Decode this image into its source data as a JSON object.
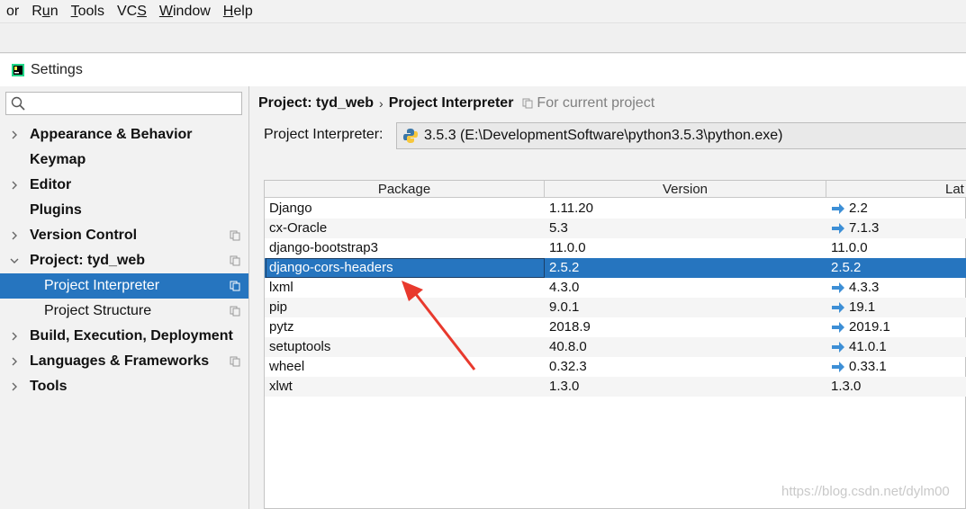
{
  "menubar": {
    "items": [
      {
        "label": "or",
        "underline": ""
      },
      {
        "label_pre": "R",
        "label_u": "u",
        "label_post": "n"
      },
      {
        "label_pre": "",
        "label_u": "T",
        "label_post": "ools"
      },
      {
        "label_pre": "VC",
        "label_u": "S",
        "label_post": ""
      },
      {
        "label_pre": "",
        "label_u": "W",
        "label_post": "indow"
      },
      {
        "label_pre": "",
        "label_u": "H",
        "label_post": "elp"
      }
    ]
  },
  "window": {
    "title": "Settings"
  },
  "sidebar": {
    "search_placeholder": "",
    "items": [
      {
        "label": "Appearance & Behavior",
        "bold": true,
        "arrow": "right"
      },
      {
        "label": "Keymap",
        "bold": true,
        "arrow": ""
      },
      {
        "label": "Editor",
        "bold": true,
        "arrow": "right"
      },
      {
        "label": "Plugins",
        "bold": true,
        "arrow": ""
      },
      {
        "label": "Version Control",
        "bold": true,
        "arrow": "right",
        "copy": true
      },
      {
        "label": "Project: tyd_web",
        "bold": true,
        "arrow": "down",
        "copy": true
      },
      {
        "label": "Project Interpreter",
        "bold": false,
        "child": true,
        "selected": true,
        "copy": true
      },
      {
        "label": "Project Structure",
        "bold": false,
        "child": true,
        "copy": true
      },
      {
        "label": "Build, Execution, Deployment",
        "bold": true,
        "arrow": "right"
      },
      {
        "label": "Languages & Frameworks",
        "bold": true,
        "arrow": "right",
        "copy": true
      },
      {
        "label": "Tools",
        "bold": true,
        "arrow": "right"
      }
    ]
  },
  "main": {
    "breadcrumb": {
      "project": "Project: tyd_web",
      "separator": "›",
      "page": "Project Interpreter",
      "scope": "For current project"
    },
    "interpreter": {
      "label": "Project Interpreter:",
      "value": "3.5.3 (E:\\DevelopmentSoftware\\python3.5.3\\python.exe)"
    },
    "table": {
      "headers": [
        "Package",
        "Version",
        "Lat"
      ],
      "rows": [
        {
          "package": "Django",
          "version": "1.11.20",
          "latest": "2.2",
          "update": true
        },
        {
          "package": "cx-Oracle",
          "version": "5.3",
          "latest": "7.1.3",
          "update": true
        },
        {
          "package": "django-bootstrap3",
          "version": "11.0.0",
          "latest": "11.0.0",
          "update": false
        },
        {
          "package": "django-cors-headers",
          "version": "2.5.2",
          "latest": "2.5.2",
          "update": false,
          "selected": true
        },
        {
          "package": "lxml",
          "version": "4.3.0",
          "latest": "4.3.3",
          "update": true
        },
        {
          "package": "pip",
          "version": "9.0.1",
          "latest": "19.1",
          "update": true
        },
        {
          "package": "pytz",
          "version": "2018.9",
          "latest": "2019.1",
          "update": true
        },
        {
          "package": "setuptools",
          "version": "40.8.0",
          "latest": "41.0.1",
          "update": true
        },
        {
          "package": "wheel",
          "version": "0.32.3",
          "latest": "0.33.1",
          "update": true
        },
        {
          "package": "xlwt",
          "version": "1.3.0",
          "latest": "1.3.0",
          "update": false
        }
      ]
    }
  },
  "watermark": "https://blog.csdn.net/dylm00",
  "colors": {
    "selection": "#2675bf",
    "update_arrow": "#3d8fd6",
    "annotation": "#e8392d"
  }
}
